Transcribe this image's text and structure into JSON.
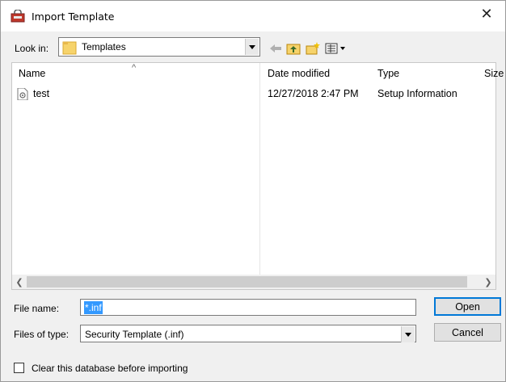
{
  "dialog": {
    "title": "Import Template",
    "close_glyph": "✕"
  },
  "lookin": {
    "label": "Look in:",
    "value": "Templates",
    "toolbar_icons": [
      "back-arrow-icon",
      "up-folder-icon",
      "new-folder-icon",
      "view-menu-icon"
    ]
  },
  "list": {
    "columns": [
      "Name",
      "Date modified",
      "Type",
      "Size"
    ],
    "rows": [
      {
        "name": "test",
        "date_modified": "12/27/2018 2:47 PM",
        "type": "Setup Information"
      }
    ]
  },
  "form": {
    "file_name_label": "File name:",
    "file_name_value": "*.inf",
    "files_of_type_label": "Files of type:",
    "files_of_type_value": "Security Template (.inf)"
  },
  "buttons": {
    "open": "Open",
    "cancel": "Cancel"
  },
  "option": {
    "clear_db_label": "Clear this database before importing",
    "checked": false
  },
  "colors": {
    "selection": "#3399ff",
    "default_button_border": "#0078d7",
    "dialog_background": "#f0f0f0"
  }
}
